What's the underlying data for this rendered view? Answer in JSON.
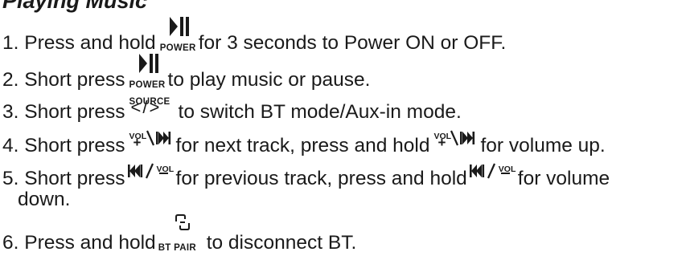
{
  "heading": "Playing Music",
  "icons": {
    "power_caption": "POWER",
    "source_caption": "SOURCE",
    "source_glyph": "</>",
    "vol_caption": "VOL",
    "bt_pair_caption": "BT PAIR"
  },
  "steps": [
    {
      "num": "1.",
      "before": "Press and hold",
      "after": "for 3 seconds to Power ON or OFF."
    },
    {
      "num": "2.",
      "before": "Short press",
      "after": "to play music or pause."
    },
    {
      "num": "3.",
      "before": "Short press",
      "after": "to switch BT mode/Aux-in mode."
    },
    {
      "num": "4.",
      "before": "Short press",
      "middle": "for next track, press and hold",
      "after": "for volume up."
    },
    {
      "num": "5.",
      "before": "Short press",
      "middle": "for previous track, press and hold",
      "after": "for volume",
      "continuation": "down."
    },
    {
      "num": "6.",
      "before": "Press and hold",
      "after": "to disconnect BT."
    }
  ]
}
